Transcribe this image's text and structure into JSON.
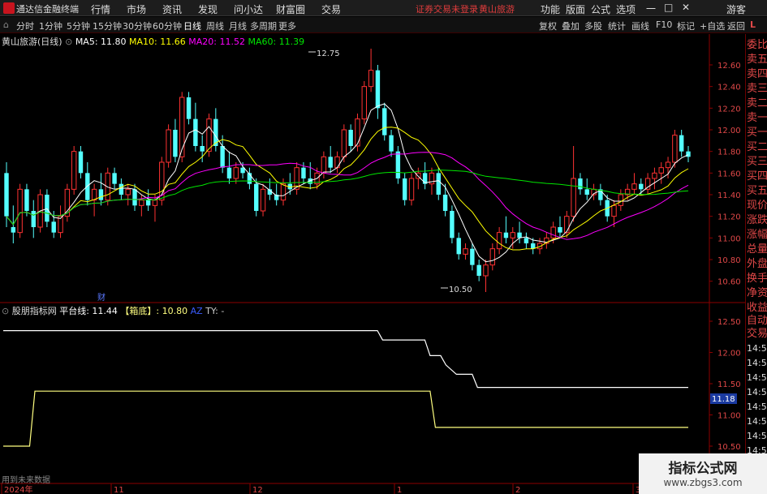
{
  "app": {
    "name": "通达信金融终端",
    "warning": "证券交易未登录",
    "stock_link": "黄山旅游"
  },
  "menu": [
    "行情",
    "市场",
    "资讯",
    "发现",
    "问小达",
    "财富圈",
    "交易"
  ],
  "topright": [
    "功能",
    "版面",
    "公式",
    "选项"
  ],
  "user": "游客",
  "window_buttons": [
    "一",
    "□",
    "✕"
  ],
  "periods": [
    "分时",
    "1分钟",
    "5分钟",
    "15分钟",
    "30分钟",
    "60分钟",
    "日线",
    "周线",
    "月线",
    "多周期",
    "更多"
  ],
  "active_period": "日线",
  "tools": [
    "复权",
    "叠加",
    "多股",
    "统计",
    "画线",
    "F10",
    "标记",
    "+自选",
    "返回"
  ],
  "main_legend": {
    "title": "黄山旅游(日线)",
    "ma5": "MA5: 11.80",
    "ma10": "MA10: 11.66",
    "ma20": "MA20: 11.52",
    "ma60": "MA60: 11.39"
  },
  "sub_legend": {
    "title": "股朋指标网",
    "ptx": "平台线: 11.44",
    "box": "【箱底】: 10.80",
    "az": "AZ",
    "ty": "TY: -"
  },
  "annotations": {
    "high": "12.75",
    "low": "10.50",
    "cai": "财"
  },
  "right_tabs": [
    "委比",
    "卖五",
    "卖四",
    "卖三",
    "卖二",
    "卖一",
    "买一",
    "买二",
    "买三",
    "买四",
    "买五",
    "现价",
    "涨跌",
    "涨幅",
    "总量",
    "外盘",
    "换手",
    "净资",
    "收益",
    "自动",
    "交易",
    "14:56",
    "14:56",
    "14:56",
    "14:56",
    "14:56",
    "14:56",
    "14:56",
    "14:56"
  ],
  "bottom_text": "用到未来数据",
  "current_price_tag": "11.18",
  "x_axis_labels": [
    "2024年",
    "11",
    "12",
    "1",
    "2",
    "3"
  ],
  "colors": {
    "up": "#ff3232",
    "down": "#54ffff",
    "ma5": "#ffffff",
    "ma10": "#ffff00",
    "ma20": "#ff00ff",
    "ma60": "#00e600",
    "platform": "#ffffff",
    "boxbottom": "#ffff80"
  },
  "watermark": {
    "line1": "指标公式网",
    "line2": "www.zbgs3.com"
  },
  "chart_data": [
    {
      "type": "candlestick",
      "title": "黄山旅游(日线)",
      "ylim": [
        10.5,
        12.75
      ],
      "y_ticks": [
        10.6,
        10.8,
        11.0,
        11.2,
        11.4,
        11.6,
        11.8,
        12.0,
        12.2,
        12.4,
        12.6
      ],
      "candles": [
        {
          "o": 11.6,
          "h": 11.7,
          "l": 11.1,
          "c": 11.2
        },
        {
          "o": 11.1,
          "h": 11.3,
          "l": 10.95,
          "c": 11.05
        },
        {
          "o": 11.05,
          "h": 11.5,
          "l": 11.0,
          "c": 11.45
        },
        {
          "o": 11.45,
          "h": 11.5,
          "l": 11.2,
          "c": 11.25
        },
        {
          "o": 11.25,
          "h": 11.35,
          "l": 11.0,
          "c": 11.1
        },
        {
          "o": 11.1,
          "h": 11.45,
          "l": 11.05,
          "c": 11.4
        },
        {
          "o": 11.4,
          "h": 11.45,
          "l": 11.1,
          "c": 11.15
        },
        {
          "o": 11.15,
          "h": 11.25,
          "l": 11.0,
          "c": 11.05
        },
        {
          "o": 11.05,
          "h": 11.3,
          "l": 11.0,
          "c": 11.2
        },
        {
          "o": 11.2,
          "h": 11.5,
          "l": 11.15,
          "c": 11.45
        },
        {
          "o": 11.45,
          "h": 11.85,
          "l": 11.4,
          "c": 11.8
        },
        {
          "o": 11.8,
          "h": 11.85,
          "l": 11.55,
          "c": 11.6
        },
        {
          "o": 11.6,
          "h": 11.7,
          "l": 11.3,
          "c": 11.35
        },
        {
          "o": 11.35,
          "h": 11.5,
          "l": 11.2,
          "c": 11.45
        },
        {
          "o": 11.45,
          "h": 11.6,
          "l": 11.3,
          "c": 11.35
        },
        {
          "o": 11.35,
          "h": 11.65,
          "l": 11.3,
          "c": 11.6
        },
        {
          "o": 11.6,
          "h": 11.65,
          "l": 11.45,
          "c": 11.5
        },
        {
          "o": 11.5,
          "h": 11.55,
          "l": 11.35,
          "c": 11.4
        },
        {
          "o": 11.4,
          "h": 11.5,
          "l": 11.3,
          "c": 11.45
        },
        {
          "o": 11.45,
          "h": 11.5,
          "l": 11.25,
          "c": 11.3
        },
        {
          "o": 11.3,
          "h": 11.4,
          "l": 11.2,
          "c": 11.35
        },
        {
          "o": 11.35,
          "h": 11.45,
          "l": 11.25,
          "c": 11.3
        },
        {
          "o": 11.3,
          "h": 11.4,
          "l": 11.15,
          "c": 11.35
        },
        {
          "o": 11.35,
          "h": 11.75,
          "l": 11.3,
          "c": 11.7
        },
        {
          "o": 11.7,
          "h": 12.05,
          "l": 11.65,
          "c": 12.0
        },
        {
          "o": 12.0,
          "h": 12.1,
          "l": 11.7,
          "c": 11.75
        },
        {
          "o": 11.75,
          "h": 12.35,
          "l": 11.7,
          "c": 12.3
        },
        {
          "o": 12.3,
          "h": 12.35,
          "l": 12.05,
          "c": 12.1
        },
        {
          "o": 12.1,
          "h": 12.25,
          "l": 11.8,
          "c": 11.85
        },
        {
          "o": 11.85,
          "h": 11.95,
          "l": 11.7,
          "c": 11.8
        },
        {
          "o": 11.8,
          "h": 12.15,
          "l": 11.75,
          "c": 12.1
        },
        {
          "o": 12.1,
          "h": 12.2,
          "l": 11.8,
          "c": 11.85
        },
        {
          "o": 11.85,
          "h": 11.95,
          "l": 11.6,
          "c": 11.65
        },
        {
          "o": 11.65,
          "h": 11.8,
          "l": 11.5,
          "c": 11.55
        },
        {
          "o": 11.55,
          "h": 11.7,
          "l": 11.5,
          "c": 11.65
        },
        {
          "o": 11.65,
          "h": 11.7,
          "l": 11.55,
          "c": 11.6
        },
        {
          "o": 11.6,
          "h": 11.65,
          "l": 11.45,
          "c": 11.5
        },
        {
          "o": 11.5,
          "h": 11.55,
          "l": 11.2,
          "c": 11.25
        },
        {
          "o": 11.25,
          "h": 11.5,
          "l": 11.2,
          "c": 11.45
        },
        {
          "o": 11.45,
          "h": 11.55,
          "l": 11.35,
          "c": 11.4
        },
        {
          "o": 11.4,
          "h": 11.5,
          "l": 11.3,
          "c": 11.35
        },
        {
          "o": 11.35,
          "h": 11.55,
          "l": 11.3,
          "c": 11.5
        },
        {
          "o": 11.5,
          "h": 11.6,
          "l": 11.4,
          "c": 11.45
        },
        {
          "o": 11.45,
          "h": 11.7,
          "l": 11.4,
          "c": 11.65
        },
        {
          "o": 11.65,
          "h": 11.7,
          "l": 11.5,
          "c": 11.55
        },
        {
          "o": 11.55,
          "h": 11.7,
          "l": 11.45,
          "c": 11.5
        },
        {
          "o": 11.5,
          "h": 11.65,
          "l": 11.45,
          "c": 11.6
        },
        {
          "o": 11.6,
          "h": 11.8,
          "l": 11.55,
          "c": 11.75
        },
        {
          "o": 11.75,
          "h": 11.85,
          "l": 11.6,
          "c": 11.65
        },
        {
          "o": 11.65,
          "h": 11.8,
          "l": 11.6,
          "c": 11.75
        },
        {
          "o": 11.75,
          "h": 12.05,
          "l": 11.7,
          "c": 12.0
        },
        {
          "o": 12.0,
          "h": 12.05,
          "l": 11.8,
          "c": 11.85
        },
        {
          "o": 11.85,
          "h": 12.15,
          "l": 11.8,
          "c": 12.1
        },
        {
          "o": 12.1,
          "h": 12.45,
          "l": 12.05,
          "c": 12.4
        },
        {
          "o": 12.4,
          "h": 12.75,
          "l": 12.35,
          "c": 12.55
        },
        {
          "o": 12.55,
          "h": 12.6,
          "l": 12.1,
          "c": 12.2
        },
        {
          "o": 12.2,
          "h": 12.25,
          "l": 11.9,
          "c": 11.95
        },
        {
          "o": 11.95,
          "h": 12.0,
          "l": 11.75,
          "c": 11.8
        },
        {
          "o": 11.8,
          "h": 11.85,
          "l": 11.5,
          "c": 11.55
        },
        {
          "o": 11.55,
          "h": 11.6,
          "l": 11.3,
          "c": 11.35
        },
        {
          "o": 11.35,
          "h": 11.6,
          "l": 11.3,
          "c": 11.55
        },
        {
          "o": 11.55,
          "h": 11.65,
          "l": 11.45,
          "c": 11.6
        },
        {
          "o": 11.6,
          "h": 11.7,
          "l": 11.45,
          "c": 11.5
        },
        {
          "o": 11.5,
          "h": 11.65,
          "l": 11.4,
          "c": 11.6
        },
        {
          "o": 11.6,
          "h": 11.65,
          "l": 11.35,
          "c": 11.4
        },
        {
          "o": 11.4,
          "h": 11.5,
          "l": 11.2,
          "c": 11.25
        },
        {
          "o": 11.25,
          "h": 11.3,
          "l": 10.95,
          "c": 11.0
        },
        {
          "o": 11.0,
          "h": 11.05,
          "l": 10.8,
          "c": 10.85
        },
        {
          "o": 10.85,
          "h": 10.95,
          "l": 10.8,
          "c": 10.9
        },
        {
          "o": 10.9,
          "h": 10.95,
          "l": 10.7,
          "c": 10.75
        },
        {
          "o": 10.75,
          "h": 10.8,
          "l": 10.6,
          "c": 10.65
        },
        {
          "o": 10.65,
          "h": 10.8,
          "l": 10.5,
          "c": 10.75
        },
        {
          "o": 10.75,
          "h": 10.95,
          "l": 10.7,
          "c": 10.9
        },
        {
          "o": 10.9,
          "h": 11.1,
          "l": 10.85,
          "c": 11.05
        },
        {
          "o": 11.05,
          "h": 11.2,
          "l": 10.95,
          "c": 11.0
        },
        {
          "o": 11.0,
          "h": 11.1,
          "l": 10.9,
          "c": 11.05
        },
        {
          "o": 11.05,
          "h": 11.15,
          "l": 10.95,
          "c": 11.0
        },
        {
          "o": 11.0,
          "h": 11.05,
          "l": 10.9,
          "c": 10.95
        },
        {
          "o": 10.95,
          "h": 11.0,
          "l": 10.85,
          "c": 10.9
        },
        {
          "o": 10.9,
          "h": 11.0,
          "l": 10.85,
          "c": 10.95
        },
        {
          "o": 10.95,
          "h": 11.05,
          "l": 10.9,
          "c": 11.0
        },
        {
          "o": 11.0,
          "h": 11.15,
          "l": 10.95,
          "c": 11.1
        },
        {
          "o": 11.1,
          "h": 11.2,
          "l": 11.0,
          "c": 11.05
        },
        {
          "o": 11.05,
          "h": 11.25,
          "l": 11.0,
          "c": 11.2
        },
        {
          "o": 11.2,
          "h": 11.85,
          "l": 11.15,
          "c": 11.55
        },
        {
          "o": 11.55,
          "h": 11.6,
          "l": 11.4,
          "c": 11.45
        },
        {
          "o": 11.45,
          "h": 11.55,
          "l": 11.35,
          "c": 11.4
        },
        {
          "o": 11.4,
          "h": 11.5,
          "l": 11.35,
          "c": 11.45
        },
        {
          "o": 11.45,
          "h": 11.5,
          "l": 11.3,
          "c": 11.35
        },
        {
          "o": 11.35,
          "h": 11.4,
          "l": 11.15,
          "c": 11.2
        },
        {
          "o": 11.2,
          "h": 11.35,
          "l": 11.1,
          "c": 11.3
        },
        {
          "o": 11.3,
          "h": 11.45,
          "l": 11.25,
          "c": 11.4
        },
        {
          "o": 11.4,
          "h": 11.5,
          "l": 11.35,
          "c": 11.45
        },
        {
          "o": 11.45,
          "h": 11.6,
          "l": 11.4,
          "c": 11.5
        },
        {
          "o": 11.5,
          "h": 11.55,
          "l": 11.4,
          "c": 11.45
        },
        {
          "o": 11.45,
          "h": 11.6,
          "l": 11.4,
          "c": 11.55
        },
        {
          "o": 11.55,
          "h": 11.65,
          "l": 11.45,
          "c": 11.6
        },
        {
          "o": 11.6,
          "h": 11.7,
          "l": 11.5,
          "c": 11.65
        },
        {
          "o": 11.65,
          "h": 11.75,
          "l": 11.55,
          "c": 11.7
        },
        {
          "o": 11.7,
          "h": 12.0,
          "l": 11.65,
          "c": 11.95
        },
        {
          "o": 11.95,
          "h": 12.0,
          "l": 11.75,
          "c": 11.8
        },
        {
          "o": 11.8,
          "h": 11.85,
          "l": 11.7,
          "c": 11.75
        }
      ]
    },
    {
      "type": "line",
      "title": "股朋指标网",
      "ylim": [
        10.5,
        12.5
      ],
      "y_ticks": [
        10.5,
        11.0,
        11.5,
        12.0,
        12.5
      ],
      "series": [
        {
          "name": "平台线",
          "points": [
            [
              0,
              12.35
            ],
            [
              71,
              12.35
            ],
            [
              72,
              12.2
            ],
            [
              80,
              12.2
            ],
            [
              81,
              11.95
            ],
            [
              83,
              11.95
            ],
            [
              84,
              11.8
            ],
            [
              86,
              11.65
            ],
            [
              89,
              11.65
            ],
            [
              90,
              11.44
            ],
            [
              130,
              11.44
            ]
          ]
        },
        {
          "name": "箱底",
          "points": [
            [
              0,
              10.5
            ],
            [
              5,
              10.5
            ],
            [
              6,
              11.38
            ],
            [
              81,
              11.38
            ],
            [
              82,
              10.8
            ],
            [
              130,
              10.8
            ]
          ]
        }
      ]
    }
  ]
}
